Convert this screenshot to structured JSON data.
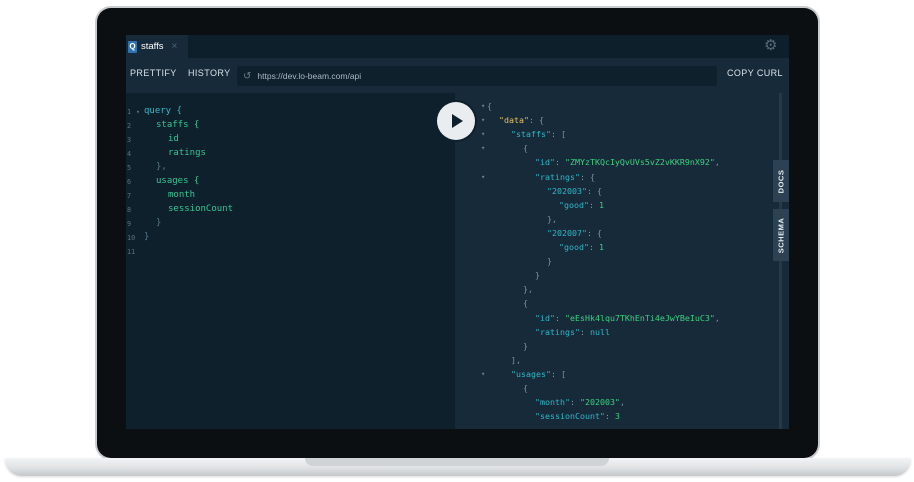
{
  "tab": {
    "logo": "Q",
    "title": "staffs",
    "close": "×"
  },
  "toolbar": {
    "prettify": "PRETTIFY",
    "history": "HISTORY",
    "url": "https://dev.lo-beam.com/api",
    "copy_curl": "COPY CURL"
  },
  "icons": {
    "gear": "gear-icon",
    "history": "history-icon",
    "play": "play-icon"
  },
  "side_tabs": {
    "docs": "DOCS",
    "schema": "SCHEMA"
  },
  "editor": {
    "line_numbers": [
      "1",
      "2",
      "3",
      "4",
      "5",
      "6",
      "7",
      "8",
      "9",
      "10",
      "11"
    ],
    "lines": [
      {
        "text": "query {",
        "cls": "kw"
      },
      {
        "text": "staffs {",
        "cls": "fld"
      },
      {
        "text": "id",
        "cls": "fld"
      },
      {
        "text": "ratings",
        "cls": "fld"
      },
      {
        "text": "},",
        "cls": "pun"
      },
      {
        "text": "usages {",
        "cls": "fld"
      },
      {
        "text": "month",
        "cls": "fld"
      },
      {
        "text": "sessionCount",
        "cls": "fld"
      },
      {
        "text": "}",
        "cls": "pun"
      },
      {
        "text": "}",
        "cls": "pun"
      }
    ]
  },
  "response": {
    "lines": [
      {
        "t": [
          [
            "{",
            "p"
          ]
        ]
      },
      {
        "t": [
          [
            "\"data\"",
            "k-root"
          ],
          [
            ": {",
            "p"
          ]
        ]
      },
      {
        "t": [
          [
            "\"staffs\"",
            "k"
          ],
          [
            ": [",
            "p"
          ]
        ]
      },
      {
        "t": [
          [
            "{",
            "p"
          ]
        ]
      },
      {
        "t": [
          [
            "\"id\"",
            "k"
          ],
          [
            ": ",
            "p"
          ],
          [
            "\"ZMYzTKQcIyQvUVs5vZ2vKKR9nX92\"",
            "s"
          ],
          [
            ",",
            "p"
          ]
        ]
      },
      {
        "t": [
          [
            "\"ratings\"",
            "k"
          ],
          [
            ": {",
            "p"
          ]
        ]
      },
      {
        "t": [
          [
            "\"202003\"",
            "k"
          ],
          [
            ": {",
            "p"
          ]
        ]
      },
      {
        "t": [
          [
            "\"good\"",
            "k"
          ],
          [
            ": ",
            "p"
          ],
          [
            "1",
            "n"
          ]
        ]
      },
      {
        "t": [
          [
            "},",
            "p"
          ]
        ]
      },
      {
        "t": [
          [
            "\"202007\"",
            "k"
          ],
          [
            ": {",
            "p"
          ]
        ]
      },
      {
        "t": [
          [
            "\"good\"",
            "k"
          ],
          [
            ": ",
            "p"
          ],
          [
            "1",
            "n"
          ]
        ]
      },
      {
        "t": [
          [
            "}",
            "p"
          ]
        ]
      },
      {
        "t": [
          [
            "}",
            "p"
          ]
        ]
      },
      {
        "t": [
          [
            "},",
            "p"
          ]
        ]
      },
      {
        "t": [
          [
            "{",
            "p"
          ]
        ]
      },
      {
        "t": [
          [
            "\"id\"",
            "k"
          ],
          [
            ": ",
            "p"
          ],
          [
            "\"eEsHk4lqu7TKhEnTi4eJwYBeIuC3\"",
            "s"
          ],
          [
            ",",
            "p"
          ]
        ]
      },
      {
        "t": [
          [
            "\"ratings\"",
            "k"
          ],
          [
            ": ",
            "p"
          ],
          [
            "null",
            "nul"
          ]
        ]
      },
      {
        "t": [
          [
            "}",
            "p"
          ]
        ]
      },
      {
        "t": [
          [
            "],",
            "p"
          ]
        ]
      },
      {
        "t": [
          [
            "\"usages\"",
            "k"
          ],
          [
            ": [",
            "p"
          ]
        ]
      },
      {
        "t": [
          [
            "{",
            "p"
          ]
        ]
      },
      {
        "t": [
          [
            "\"month\"",
            "k"
          ],
          [
            ": ",
            "p"
          ],
          [
            "\"202003\"",
            "s"
          ],
          [
            ",",
            "p"
          ]
        ]
      },
      {
        "t": [
          [
            "\"sessionCount\"",
            "k"
          ],
          [
            ": ",
            "p"
          ],
          [
            "3",
            "n"
          ]
        ]
      }
    ]
  }
}
